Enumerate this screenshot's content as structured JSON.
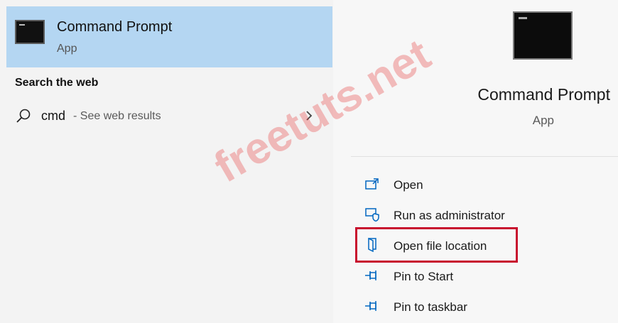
{
  "best_match": {
    "title": "Command Prompt",
    "subtitle": "App"
  },
  "web_section": {
    "heading": "Search the web"
  },
  "web_result": {
    "query": "cmd",
    "hint": "- See web results"
  },
  "detail": {
    "title": "Command Prompt",
    "subtitle": "App"
  },
  "actions": [
    {
      "label": "Open",
      "icon": "open-window-icon"
    },
    {
      "label": "Run as administrator",
      "icon": "shield-icon"
    },
    {
      "label": "Open file location",
      "icon": "file-location-icon"
    },
    {
      "label": "Pin to Start",
      "icon": "pin-icon"
    },
    {
      "label": "Pin to taskbar",
      "icon": "pin-icon"
    }
  ],
  "highlighted_action": "Open file location",
  "watermark": "freetuts.net",
  "colors": {
    "selection": "#b4d6f2",
    "accent": "#0067c0",
    "highlight_border": "#c8102e",
    "watermark": "#e63c3c"
  }
}
